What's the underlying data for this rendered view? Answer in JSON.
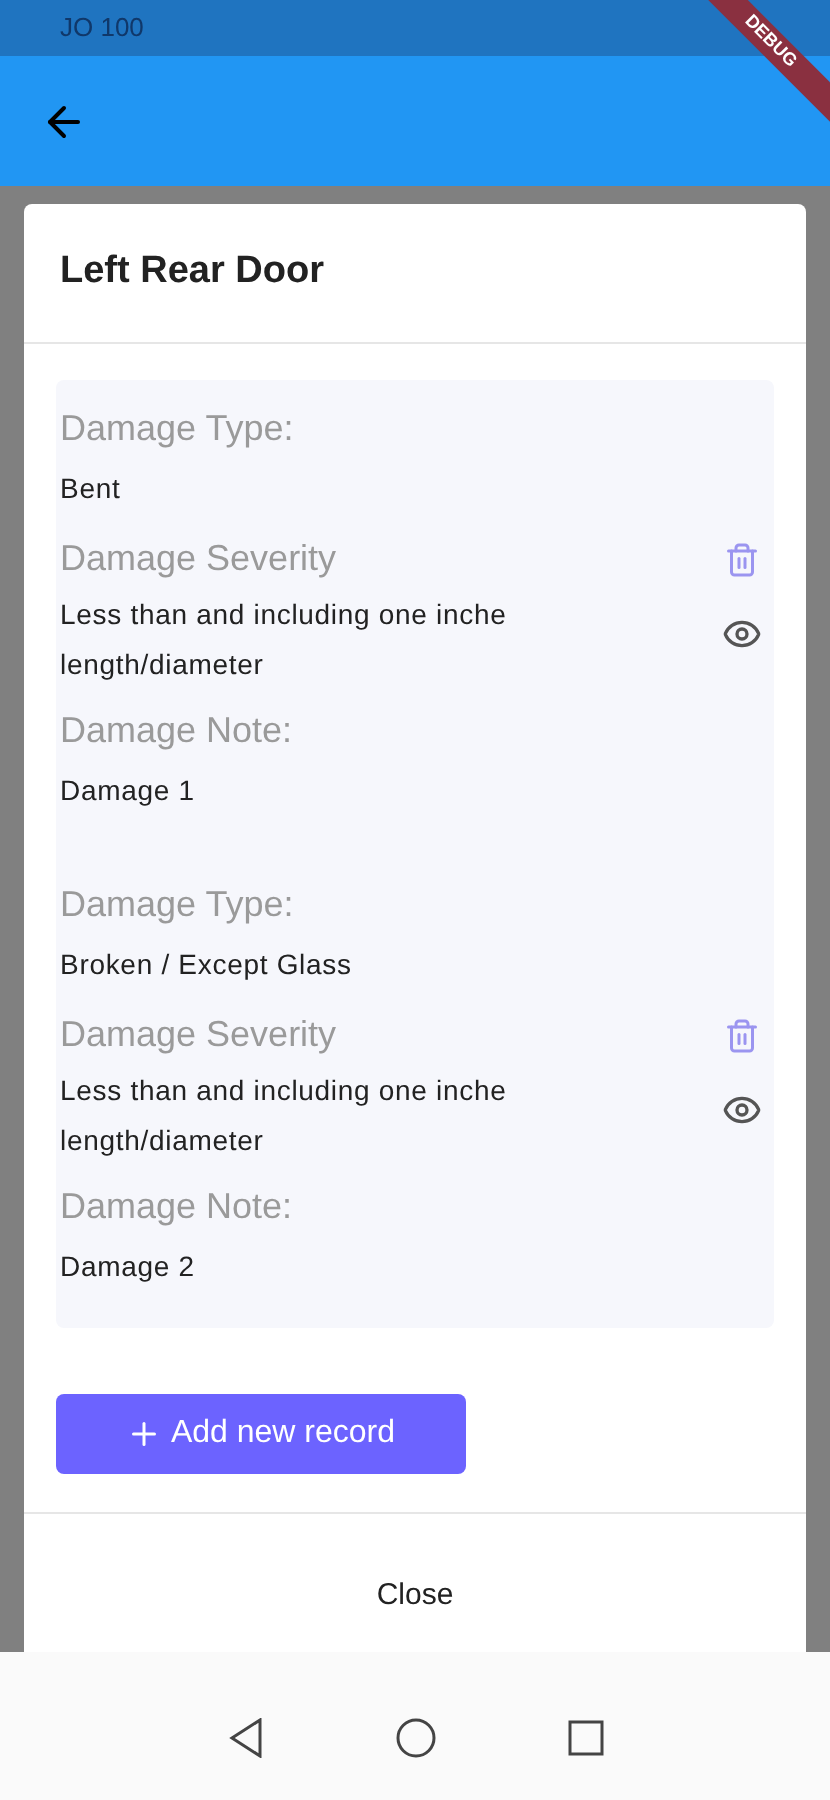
{
  "status_bar": {
    "left_text": "JO 100",
    "ribbon": "DEBUG"
  },
  "dialog": {
    "title": "Left Rear Door",
    "records": [
      {
        "type_label": "Damage Type:",
        "type_value": "Bent",
        "severity_label": "Damage Severity",
        "severity_value": "Less than and including one inche length/diameter",
        "note_label": "Damage Note:",
        "note_value": "Damage 1"
      },
      {
        "type_label": "Damage Type:",
        "type_value": "Broken / Except Glass",
        "severity_label": "Damage Severity",
        "severity_value": "Less than and including one inche length/diameter",
        "note_label": "Damage Note:",
        "note_value": "Damage 2"
      }
    ],
    "add_button": "Add new record",
    "close_button": "Close"
  }
}
